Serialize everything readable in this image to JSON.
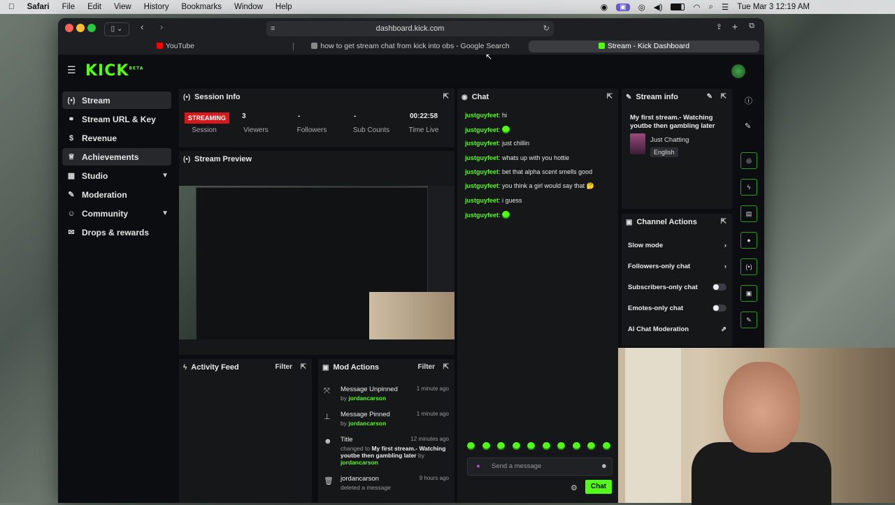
{
  "menubar": {
    "apple": "",
    "app": "Safari",
    "items": [
      "File",
      "Edit",
      "View",
      "History",
      "Bookmarks",
      "Window",
      "Help"
    ],
    "clock": "Tue Mar 3  12:19 AM"
  },
  "browser": {
    "url": "dashboard.kick.com",
    "tabs": [
      {
        "label": "YouTube",
        "fav_color": "#ff0000"
      },
      {
        "label": "how to get stream chat from kick into obs - Google Search",
        "fav_color": "#888888"
      },
      {
        "label": "Stream - Kick Dashboard",
        "fav_color": "#53fc18"
      }
    ]
  },
  "header": {
    "logo": "KICK",
    "logo_tag": "BETA"
  },
  "sidebar": {
    "items": [
      {
        "label": "Stream",
        "icon": "broadcast-icon"
      },
      {
        "label": "Stream URL & Key",
        "icon": "link-icon"
      },
      {
        "label": "Revenue",
        "icon": "dollar-icon"
      },
      {
        "label": "Achievements",
        "icon": "trophy-icon"
      },
      {
        "label": "Studio",
        "icon": "grid-icon"
      },
      {
        "label": "Moderation",
        "icon": "wrench-icon"
      },
      {
        "label": "Community",
        "icon": "people-icon"
      },
      {
        "label": "Drops & rewards",
        "icon": "gift-icon"
      }
    ]
  },
  "session": {
    "title": "Session Info",
    "status": "STREAMING",
    "status_label": "Session",
    "viewers": "3",
    "viewers_label": "Viewers",
    "followers": "-",
    "followers_label": "Followers",
    "subs": "-",
    "subs_label": "Sub Counts",
    "time": "00:22:58",
    "time_label": "Time Live"
  },
  "preview": {
    "title": "Stream Preview"
  },
  "activity": {
    "title": "Activity Feed",
    "filter": "Filter"
  },
  "mod": {
    "title": "Mod Actions",
    "filter": "Filter",
    "actions": [
      {
        "title": "Message Unpinned",
        "time": "1 minute ago",
        "pre": "by ",
        "user": "jordancarson"
      },
      {
        "title": "Message Pinned",
        "time": "1 minute ago",
        "pre": "by ",
        "user": "jordancarson"
      },
      {
        "title": "Title",
        "time": "12 minutes ago",
        "pre": "changed to ",
        "highlight": "My first stream.- Watching youtbe then gambling later",
        "post": " by ",
        "user": "jordancarson"
      },
      {
        "title": "jordancarson",
        "time": "9 hours ago",
        "pre": "deleted a message"
      }
    ]
  },
  "chat": {
    "title": "Chat",
    "messages": [
      {
        "user": "justguyfeet",
        "text": "hi"
      },
      {
        "user": "justguyfeet",
        "text": ""
      },
      {
        "user": "justguyfeet",
        "text": "just chillin"
      },
      {
        "user": "justguyfeet",
        "text": "whats up with you hottie"
      },
      {
        "user": "justguyfeet",
        "text": "bet that alpha scent smells good"
      },
      {
        "user": "justguyfeet",
        "text": "you think a girl would say that 🤔"
      },
      {
        "user": "justguyfeet",
        "text": "i guess"
      },
      {
        "user": "justguyfeet",
        "text": ""
      }
    ],
    "placeholder": "Send a message",
    "send": "Chat"
  },
  "stream_info": {
    "title": "Stream info",
    "stream_title": "My first stream.- Watching youtbe then gambling later",
    "category": "Just Chatting",
    "language": "English"
  },
  "channel_actions": {
    "title": "Channel Actions",
    "items": [
      {
        "label": "Slow mode",
        "control": "chevron"
      },
      {
        "label": "Followers-only chat",
        "control": "chevron"
      },
      {
        "label": "Subscribers-only chat",
        "control": "toggle"
      },
      {
        "label": "Emotes-only chat",
        "control": "toggle"
      },
      {
        "label": "AI Chat Moderation",
        "control": "external"
      }
    ]
  }
}
